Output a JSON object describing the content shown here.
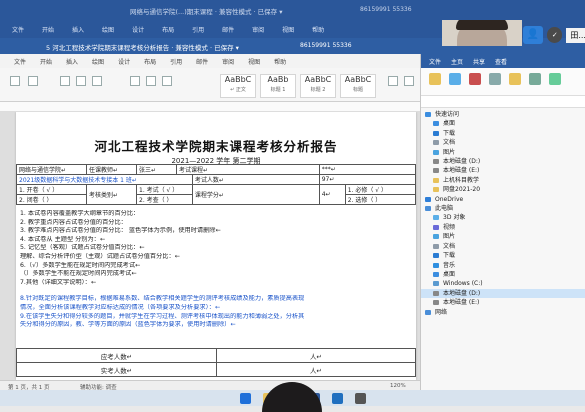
{
  "window": {
    "title_back": "网络与通信学院(...)期末课程 · 兼容性模式 · 已保存 ▾",
    "title_front": "5 河北工程技术学院期末课程考核分析报告 · 兼容性模式 · 已保存 ▾",
    "meeting_id": "86159991 55336",
    "back_tabs": [
      "文件",
      "开始",
      "插入",
      "绘图",
      "设计",
      "布局",
      "引用",
      "邮件",
      "审阅",
      "视图",
      "帮助"
    ]
  },
  "ribbon": {
    "tabs": [
      "文件",
      "开始",
      "插入",
      "绘图",
      "设计",
      "布局",
      "引用",
      "邮件",
      "审阅",
      "视图",
      "帮助"
    ],
    "styles": [
      {
        "sample": "AaBbC",
        "name": "↵ 正文"
      },
      {
        "sample": "AaBb",
        "name": "标题 1"
      },
      {
        "sample": "AaBbC",
        "name": "标题 2"
      },
      {
        "sample": "AaBbC",
        "name": "标题"
      }
    ]
  },
  "doc": {
    "title": "河北工程技术学院期末课程考核分析报告",
    "semester": "2021—2022 学年 第二学期",
    "table": {
      "row1": [
        "网络与通信学院↵",
        "任课教师↵",
        "张三↵",
        "考试课程↵",
        "***↵"
      ],
      "row2": "2021级数据科学与大数据技术专接本 1 班↵",
      "row2b": [
        "考试人数↵",
        "97↵"
      ],
      "row3a": "1. 开卷（ √ ）",
      "row3b": "2. 闭卷（ ）",
      "row3c": "考核类别↵",
      "row3d": "1. 考试（ √ ）",
      "row3e": "2. 考查（ ）",
      "row3f": "课程学分↵",
      "row3g": "4↵",
      "row3h": "课程性质↵",
      "row3i": "1. 必修（ √ ）",
      "row3j": "2. 选修（ ）"
    },
    "lines": [
      "1. 本试卷内容覆盖教学大纲章节的百分比：",
      "2. 教学重点内容占试卷分值的百分比：",
      "3. 教学难点内容占试卷分值的百分比：    蓝色字体为示例，使用时请删除←",
      "4. 本试卷从 主题型 分别为：←",
      "5. 记忆型（客观）试题占试卷分值百分比：←",
      "理解、综合分析评价型（主观）试题占试卷分值百分比：←",
      "6.（√）多数学生能在规定时间内完成考试←",
      "（）多数学生不能在规定时间内完成考试←",
      "7.其他（详细文字说明）：←",
      "",
      "8.针对既定的课程教学目标，根据难易系数、结合教学相关题学生的测评考核成绩及能力，素质提高表现",
      "情况，全面分析该课程教学对应标达成的情况（各项要求及分析要求）：←",
      "9.在该学生失分和得分较多的题目，并就学生在学习过程、测评考核中体现出的能力和薄弱之处，分析其",
      "失分和得分的原因，教、学等方面的原因（蓝色字体为要求，使用时请删除）←"
    ],
    "bottom_rows": [
      {
        "label": "应考人数↵",
        "unit": "人↵"
      },
      {
        "label": "实考人数↵",
        "unit": "人↵"
      }
    ]
  },
  "status": {
    "left": "第 1 页，共 1 页",
    "words": "辅助功能: 调查",
    "zoom": "120%"
  },
  "meeting": {
    "name": "田...",
    "avatar_icon": "person-icon"
  },
  "explorer": {
    "tabs": [
      "文件",
      "主页",
      "共享",
      "查看"
    ],
    "items": [
      {
        "label": "快速访问",
        "level": 1,
        "color": "#3c8ee0"
      },
      {
        "label": "桌面",
        "level": 2,
        "color": "#3c8ee0"
      },
      {
        "label": "下载",
        "level": 2,
        "color": "#2b7cd3"
      },
      {
        "label": "文档",
        "level": 2,
        "color": "#8e9ba8"
      },
      {
        "label": "图片",
        "level": 2,
        "color": "#4aa3df"
      },
      {
        "label": "本地磁盘 (D:)",
        "level": 2,
        "color": "#888"
      },
      {
        "label": "本地磁盘 (E:)",
        "level": 2,
        "color": "#888"
      },
      {
        "label": "上机科目教学",
        "level": 2,
        "color": "#e8c25a"
      },
      {
        "label": "网盘2021-20",
        "level": 2,
        "color": "#e8c25a"
      },
      {
        "label": "OneDrive",
        "level": 1,
        "color": "#2f7fd8"
      },
      {
        "label": "此电脑",
        "level": 1,
        "color": "#4a8ed8"
      },
      {
        "label": "3D 对象",
        "level": 2,
        "color": "#5aaee8"
      },
      {
        "label": "视频",
        "level": 2,
        "color": "#6a6ad8"
      },
      {
        "label": "图片",
        "level": 2,
        "color": "#4aa3df"
      },
      {
        "label": "文档",
        "level": 2,
        "color": "#8e9ba8"
      },
      {
        "label": "下载",
        "level": 2,
        "color": "#2b7cd3"
      },
      {
        "label": "音乐",
        "level": 2,
        "color": "#2f8fe0"
      },
      {
        "label": "桌面",
        "level": 2,
        "color": "#3c8ee0"
      },
      {
        "label": "Windows (C:)",
        "level": 2,
        "color": "#5a9ad0"
      },
      {
        "label": "本地磁盘 (D:)",
        "level": 2,
        "color": "#888",
        "selected": true
      },
      {
        "label": "本地磁盘 (E:)",
        "level": 2,
        "color": "#888"
      },
      {
        "label": "网络",
        "level": 1,
        "color": "#4a8ed8"
      }
    ]
  }
}
